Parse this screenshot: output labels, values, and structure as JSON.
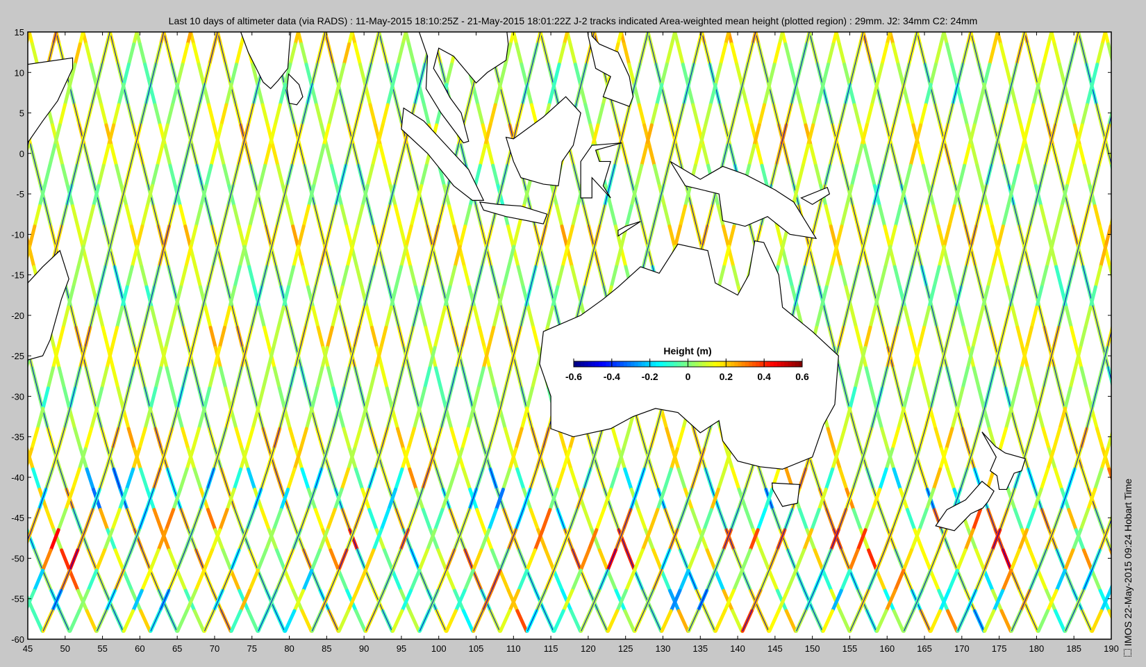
{
  "title": "Last 10 days of altimeter data (via RADS) : 11-May-2015 18:10:25Z - 21-May-2015 18:01:22Z  J-2 tracks indicated  Area-weighted mean height (plotted region) : 29mm.  J2: 34mm  C2: 24mm",
  "credit": "IMOS 22-May-2015 09:24 Hobart Time",
  "map": {
    "lon_range": [
      45,
      190
    ],
    "lat_range": [
      -60,
      15
    ],
    "x_ticks": [
      "45",
      "50",
      "55",
      "60",
      "65",
      "70",
      "75",
      "80",
      "85",
      "90",
      "95",
      "100",
      "105",
      "110",
      "115",
      "120",
      "125",
      "130",
      "135",
      "140",
      "145",
      "150",
      "155",
      "160",
      "165",
      "170",
      "175",
      "180",
      "185",
      "190"
    ],
    "y_ticks": [
      "15",
      "10",
      "5",
      "0",
      "-5",
      "-10",
      "-15",
      "-20",
      "-25",
      "-30",
      "-35",
      "-40",
      "-45",
      "-50",
      "-55",
      "-60"
    ]
  },
  "colorbar": {
    "title": "Height (m)",
    "range": [
      -0.6,
      0.6
    ],
    "tick_labels": [
      "-0.6",
      "-0.4",
      "-0.2",
      "0",
      "0.2",
      "0.4",
      "0.6"
    ],
    "colormap": "jet"
  },
  "colors": {
    "background": "#c8c8c8",
    "land": "#ffffff",
    "j2_track": "#0000cc"
  }
}
